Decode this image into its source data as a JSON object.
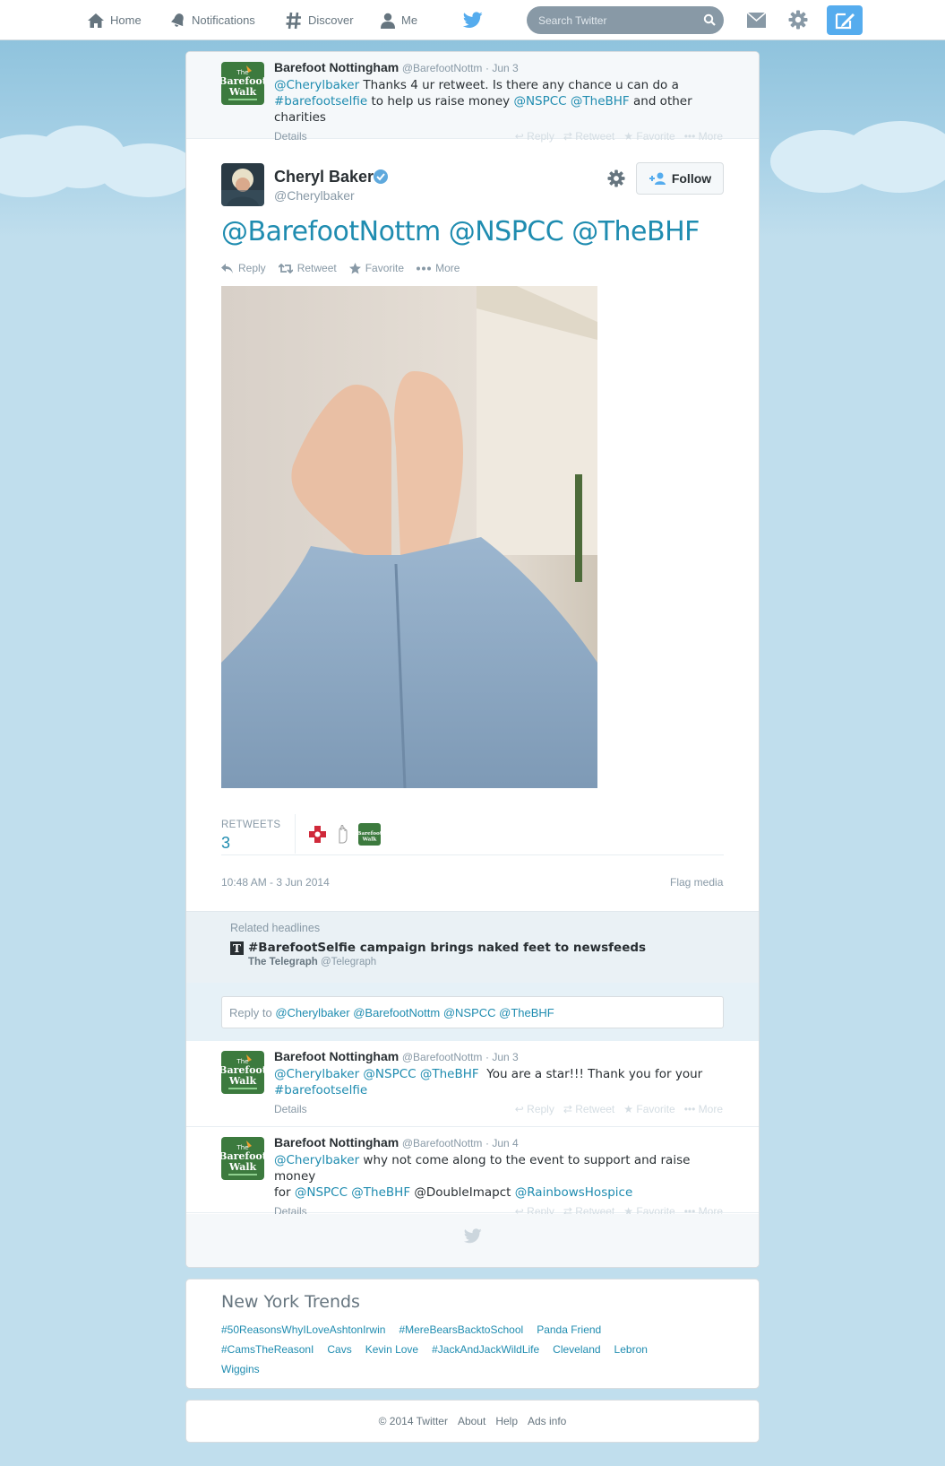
{
  "nav": {
    "home": "Home",
    "notifications": "Notifications",
    "discover": "Discover",
    "me": "Me",
    "search_placeholder": "Search Twitter"
  },
  "ancestor_tweet": {
    "name": "Barefoot Nottingham",
    "handle": "@BarefootNottm",
    "date": "· Jun 3",
    "text_line1_mention": "@Cherylbaker",
    "text_line1": " Thanks 4 ur retweet. Is there any chance u can do a",
    "text_line2_hashtag": "#barefootselfie",
    "text_line2_mid": " to help us raise money ",
    "text_line2_mention1": "@NSPCC",
    "text_line2_mention2": "@TheBHF",
    "text_line2_end": " and other charities",
    "details": "Details"
  },
  "tweet_actions_labels": {
    "reply": "Reply",
    "retweet": "Retweet",
    "favorite": "Favorite",
    "more": "More"
  },
  "permalink": {
    "name": "Cheryl Baker",
    "handle": "@Cherylbaker",
    "follow": "Follow",
    "text": "@BarefootNottm @NSPCC @TheBHF",
    "retweets_label": "RETWEETS",
    "retweets_count": "3",
    "timestamp": "10:48 AM - 3 Jun 2014",
    "flag_media": "Flag media"
  },
  "related": {
    "title": "Related headlines",
    "headline": "#BarefootSelfie campaign brings naked feet to newsfeeds",
    "source_name": "The Telegraph",
    "source_handle": "@Telegraph"
  },
  "reply_box": {
    "prefix": "Reply to ",
    "mentions": "@Cherylbaker @BarefootNottm @NSPCC @TheBHF"
  },
  "replies": [
    {
      "name": "Barefoot Nottingham",
      "handle": "@BarefootNottm",
      "date": "· Jun 3",
      "mentions": "@Cherylbaker @NSPCC @TheBHF",
      "text": "  You are a star!!! Thank you for your",
      "hashtag": "#barefootselfie",
      "details": "Details"
    },
    {
      "name": "Barefoot Nottingham",
      "handle": "@BarefootNottm",
      "date": "· Jun 4",
      "mention1": "@Cherylbaker",
      "text1": " why not come along to the event to support and raise money",
      "text2_prefix": "for ",
      "mention2": "@NSPCC @TheBHF",
      "text2_mid": " @DoubleImapct ",
      "mention3": "@RainbowsHospice",
      "details": "Details"
    }
  ],
  "trends": {
    "title": "New York Trends",
    "items": [
      "#50ReasonsWhyILoveAshtonIrwin",
      "#MereBearsBacktoSchool",
      "Panda Friend",
      "#CamsTheReasonI",
      "Cavs",
      "Kevin Love",
      "#JackAndJackWildLife",
      "Cleveland",
      "Lebron",
      "Wiggins"
    ]
  },
  "footer": {
    "copyright": "© 2014 Twitter",
    "about": "About",
    "help": "Help",
    "ads_info": "Ads info"
  },
  "logo_text": {
    "barefoot_walk_line1": "The",
    "barefoot_walk_line2": "Barefoot",
    "barefoot_walk_line3": "Walk"
  },
  "colors": {
    "link": "#1f8cb0",
    "twitter_blue": "#55acee",
    "background": "#c0deed",
    "barefoot_green": "#3c7a3e"
  },
  "icons": [
    "home-icon",
    "bell-icon",
    "hashtag-icon",
    "person-icon",
    "twitter-bird-icon",
    "search-icon",
    "envelope-icon",
    "gear-icon",
    "compose-icon",
    "verified-icon",
    "follow-person-icon",
    "reply-icon",
    "retweet-icon",
    "star-icon",
    "more-dots-icon",
    "telegraph-icon"
  ]
}
